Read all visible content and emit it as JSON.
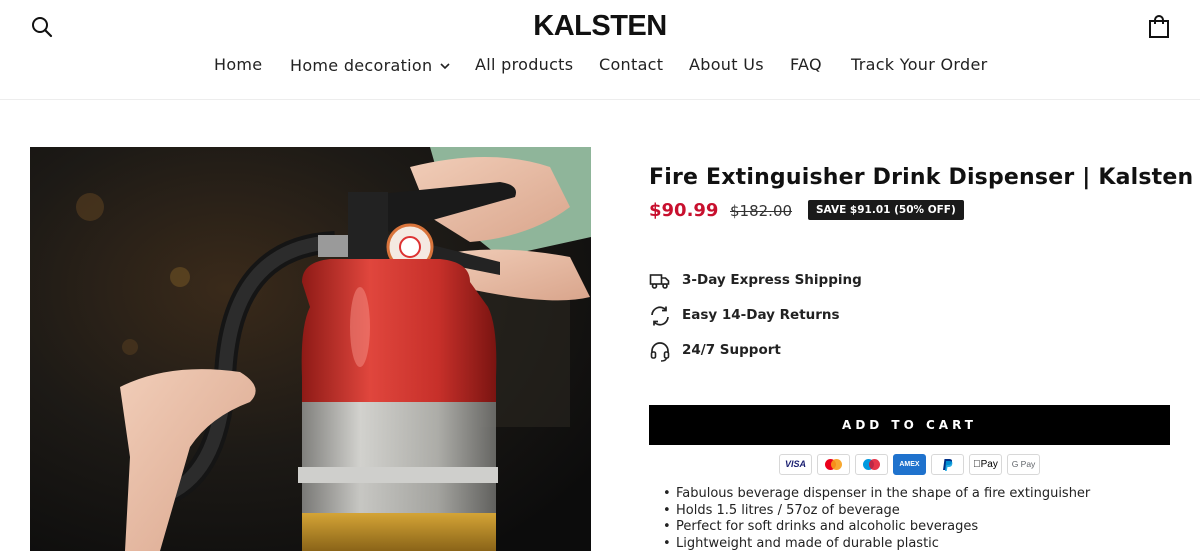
{
  "store": {
    "name": "KALSTEN"
  },
  "header": {
    "search_icon": "search-icon",
    "cart_icon": "bag-icon"
  },
  "nav": {
    "items": [
      {
        "label": "Home"
      },
      {
        "label": "Home decoration",
        "has_dropdown": true
      },
      {
        "label": "All products"
      },
      {
        "label": "Contact"
      },
      {
        "label": "About Us"
      },
      {
        "label": "FAQ"
      },
      {
        "label": "Track Your Order"
      }
    ]
  },
  "product": {
    "title": "Fire Extinguisher Drink Dispenser | Kalsten",
    "price": "$90.99",
    "compare_price": "$182.00",
    "save_badge": "SAVE $91.01 (50% OFF)",
    "features": [
      {
        "icon": "truck-icon",
        "label": "3-Day Express Shipping"
      },
      {
        "icon": "refresh-icon",
        "label": "Easy 14-Day Returns"
      },
      {
        "icon": "headset-icon",
        "label": "24/7 Support"
      }
    ],
    "add_to_cart": "ADD TO CART",
    "payment_methods": [
      "VISA",
      "Mastercard",
      "Maestro",
      "AMEX",
      "PayPal",
      "Pay",
      "G Pay"
    ],
    "description": [
      "Fabulous beverage dispenser in the shape of a fire extinguisher",
      "Holds 1.5 litres / 57oz of beverage",
      "Perfect for soft drinks and alcoholic beverages",
      "Lightweight and made of durable plastic"
    ]
  },
  "colors": {
    "price_red": "#c8102e",
    "button_black": "#000000",
    "badge_dark": "#1a1a1a"
  }
}
